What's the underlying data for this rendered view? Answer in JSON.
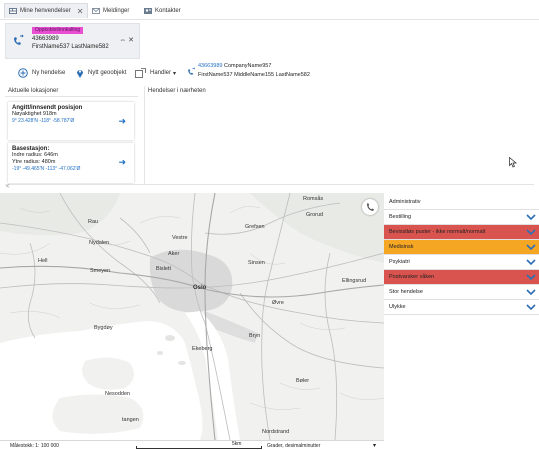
{
  "tabs": [
    {
      "label": "Mine henvendelser",
      "close": "✕"
    },
    {
      "label": "Meldinger"
    },
    {
      "label": "Kontakter"
    }
  ],
  "call_card": {
    "status": "Oppkoblet/innkalling",
    "number": "43663989",
    "name": "FirstName537 LastName582",
    "controls": "⇔ ✕"
  },
  "toolbar": {
    "new_incident": "Ny hendelse",
    "new_geo": "Nytt geoobjekt",
    "actions": "Handler",
    "active_call_number": "43663989",
    "active_call_company": "CompanyName957",
    "active_call_name": "FirstName537 MiddleName155 LastName582"
  },
  "locations": {
    "header": "Aktuelle lokasjoner",
    "cards": [
      {
        "title": "Angitt/innsendt posisjon",
        "lines": [
          "Nøyaktighet 918m"
        ],
        "coords": "9° 23.428'N -118° -58.787'Ø"
      },
      {
        "title": "Basestasjon:",
        "lines": [
          "Indre radius: 646m",
          "Ytre radius: 480m"
        ],
        "coords": "-19° -49.465'N -113° -47.062'Ø"
      }
    ]
  },
  "nearby": {
    "header": "Hendelser i nærheten"
  },
  "scroll_left": "<",
  "map": {
    "labels": [
      "Rau",
      "Romsås",
      "Grorud",
      "Grefsen",
      "Vestre",
      "Aker",
      "Nydalen",
      "Hell",
      "Bislett",
      "Sinsen",
      "Oslo",
      "Smeyen",
      "Ellingsrud",
      "Øvre",
      "Bygdøy",
      "Ekeberg",
      "Bryn",
      "Nesodden",
      "tangen",
      "Bøler",
      "Nordstrand"
    ],
    "scale_label": "Målestokk: 1: 100 000",
    "scale_km": "5km",
    "coord_format": "Grader, desimalminutter",
    "coord_dropdown": "▾"
  },
  "categories": [
    {
      "label": "Administrativ",
      "color": "#ffffff",
      "chevron": false
    },
    {
      "label": "Bestilling",
      "color": "#ffffff",
      "chevron": true
    },
    {
      "label": "Bevisstløs puster - ikke normalt/normalt",
      "color": "#d9544f",
      "chevron": true
    },
    {
      "label": "Medisinsk",
      "color": "#f5a623",
      "chevron": true
    },
    {
      "label": "Psykiatri",
      "color": "#ffffff",
      "chevron": true
    },
    {
      "label": "Postvarsker våken",
      "color": "#d9544f",
      "chevron": true
    },
    {
      "label": "Stor hendelse",
      "color": "#ffffff",
      "chevron": true
    },
    {
      "label": "Ulykke",
      "color": "#ffffff",
      "chevron": true
    }
  ]
}
